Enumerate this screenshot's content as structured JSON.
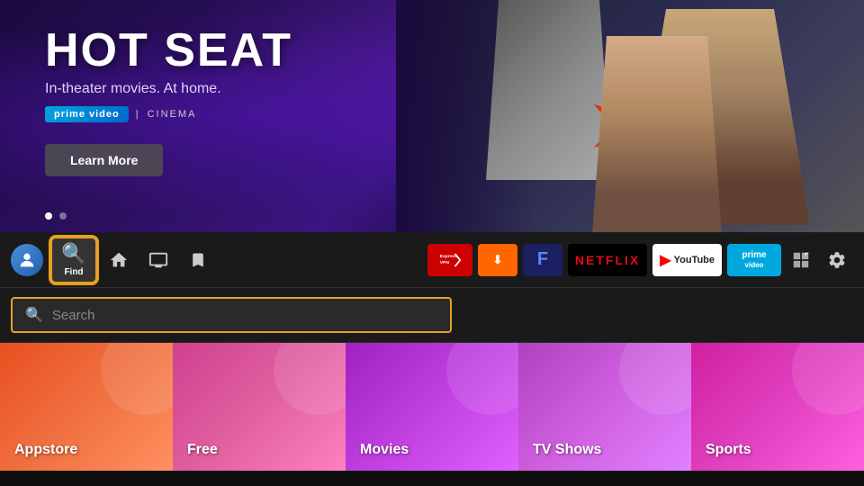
{
  "hero": {
    "title": "HOT SEAT",
    "subtitle": "In-theater movies. At home.",
    "brand": "prime video",
    "cinema": "CINEMA",
    "learn_more": "Learn More",
    "dots": [
      {
        "active": true
      },
      {
        "active": false
      }
    ]
  },
  "navbar": {
    "profile_icon": "👤",
    "find_label": "Find",
    "home_icon": "⌂",
    "tv_icon": "📺",
    "bookmark_icon": "🔖",
    "apps": [
      {
        "name": "ExpressVPN",
        "key": "expressvpn"
      },
      {
        "name": "Downloader",
        "key": "downloader"
      },
      {
        "name": "F",
        "key": "f"
      },
      {
        "name": "NETFLIX",
        "key": "netflix"
      },
      {
        "name": "YouTube",
        "key": "youtube"
      },
      {
        "name": "prime video",
        "key": "prime"
      }
    ],
    "grid_icon": "⊞",
    "settings_icon": "⚙"
  },
  "search": {
    "placeholder": "Search"
  },
  "categories": [
    {
      "label": "Appstore",
      "color_key": "orange"
    },
    {
      "label": "Free",
      "color_key": "pink"
    },
    {
      "label": "Movies",
      "color_key": "purple"
    },
    {
      "label": "TV Shows",
      "color_key": "violet"
    },
    {
      "label": "Sports",
      "color_key": "magenta"
    }
  ]
}
